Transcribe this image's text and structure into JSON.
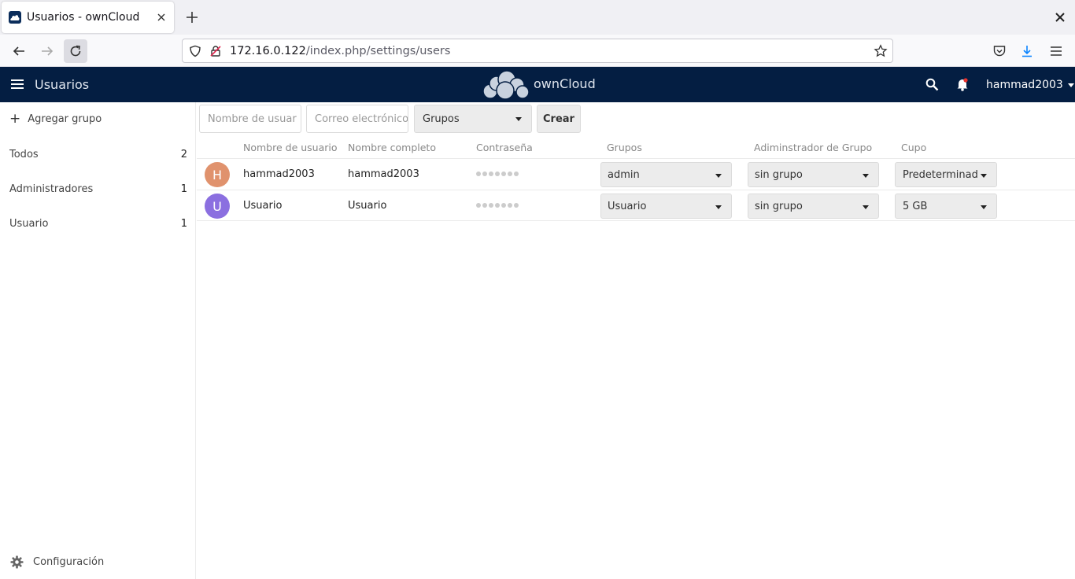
{
  "browser": {
    "tab_title": "Usuarios - ownCloud",
    "url_host": "172.16.0.122",
    "url_path": "/index.php/settings/users"
  },
  "header": {
    "app_title": "Usuarios",
    "brand": "ownCloud",
    "user": "hammad2003"
  },
  "sidebar": {
    "add_group": "Agregar grupo",
    "items": [
      {
        "label": "Todos",
        "count": "2"
      },
      {
        "label": "Administradores",
        "count": "1"
      },
      {
        "label": "Usuario",
        "count": "1"
      }
    ],
    "settings": "Configuración"
  },
  "new_user": {
    "username_placeholder": "Nombre de usuar",
    "email_placeholder": "Correo electrónico",
    "groups_label": "Grupos",
    "create_label": "Crear"
  },
  "table": {
    "headers": {
      "username": "Nombre de usuario",
      "fullname": "Nombre completo",
      "password": "Contraseña",
      "groups": "Grupos",
      "group_admin": "Adiminstrador de Grupo",
      "quota": "Cupo"
    },
    "rows": [
      {
        "initial": "H",
        "avatar_color": "#e0926d",
        "username": "hammad2003",
        "fullname": "hammad2003",
        "groups": "admin",
        "group_admin": "sin grupo",
        "quota": "Predeterminado"
      },
      {
        "initial": "U",
        "avatar_color": "#8b6fe0",
        "username": "Usuario",
        "fullname": "Usuario",
        "groups": "Usuario",
        "group_admin": "sin grupo",
        "quota": "5 GB"
      }
    ]
  }
}
